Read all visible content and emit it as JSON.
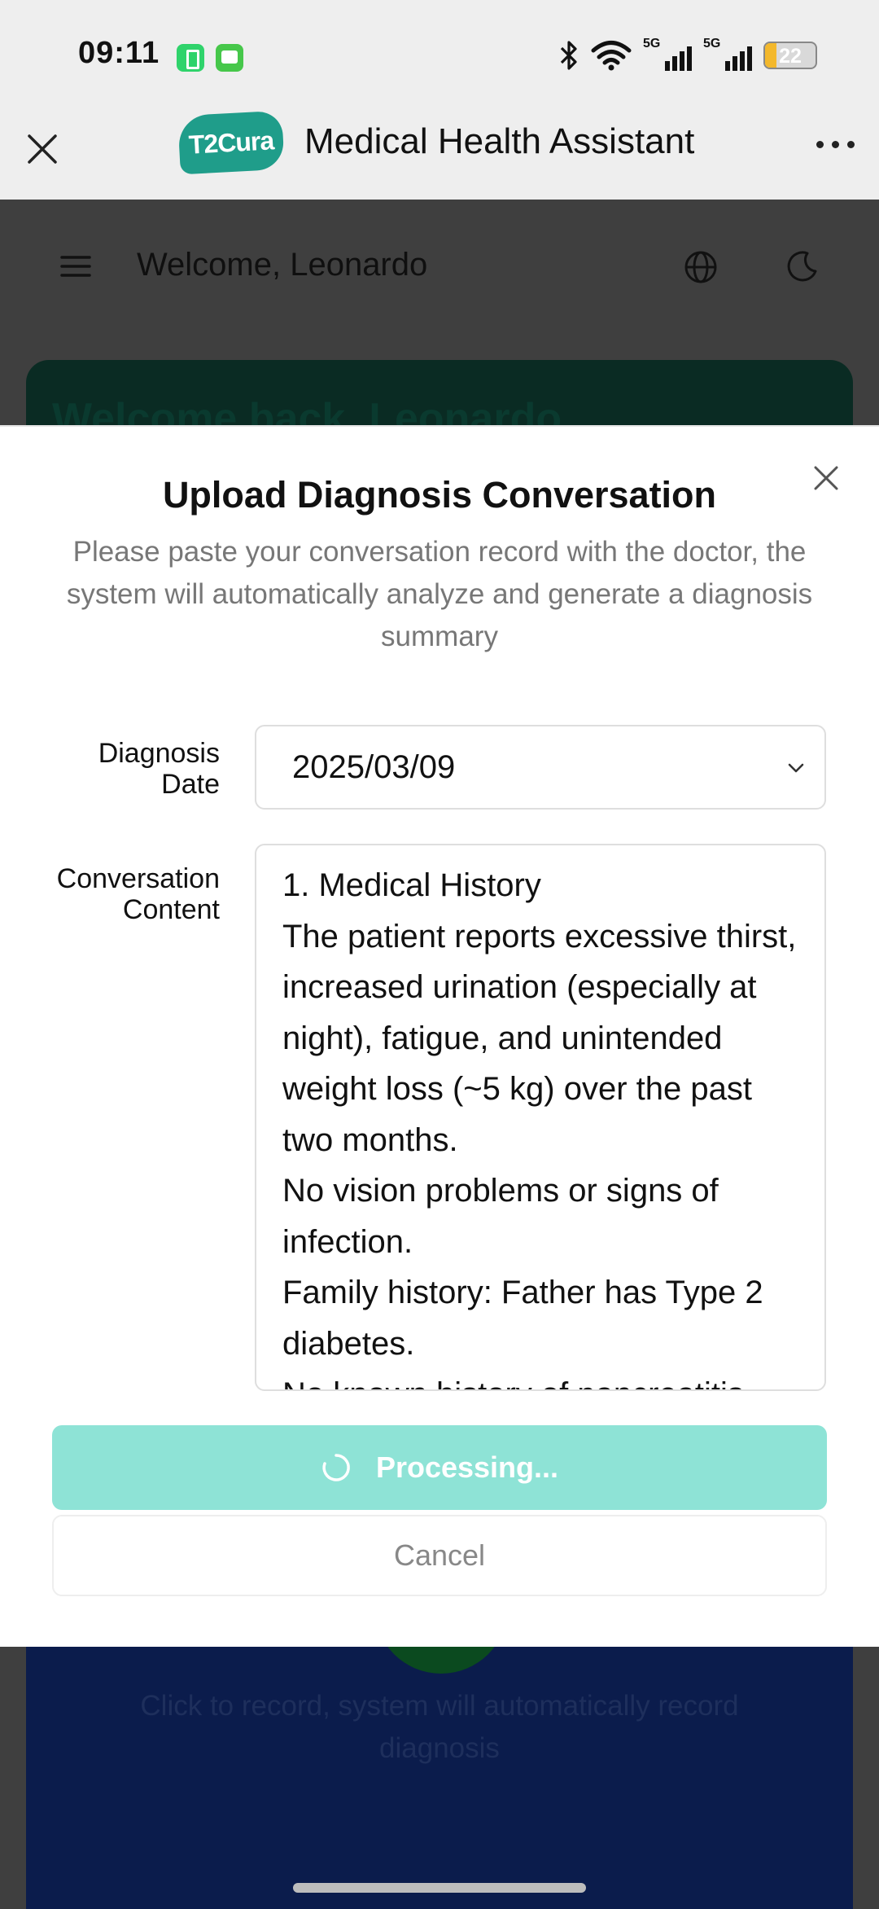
{
  "status_bar": {
    "time": "09:11",
    "network_1": "5G",
    "network_2": "5G",
    "battery_percent": "22",
    "battery_level": 0.22,
    "icons": [
      "battery-saver-icon",
      "messages-icon",
      "bluetooth-icon",
      "wifi-icon",
      "signal-icon",
      "battery-icon"
    ]
  },
  "app_bar": {
    "logo_text": "T2Cura",
    "title": "Medical Health Assistant",
    "icons": [
      "close-icon",
      "more-icon"
    ],
    "brand_color": "#1f9d8a"
  },
  "background_page": {
    "welcome": "Welcome, Leonardo",
    "welcome_back": "Welcome back, Leonardo",
    "record_hint": "Click to record, system will automatically record diagnosis",
    "icons": [
      "menu-icon",
      "globe-icon",
      "moon-icon",
      "microphone-icon"
    ]
  },
  "modal": {
    "title": "Upload Diagnosis Conversation",
    "description": "Please paste your conversation record with the doctor, the system will automatically analyze and generate a diagnosis summary",
    "date_label": "Diagnosis Date",
    "date_value": "2025/03/09",
    "content_label": "Conversation Content",
    "content_text": "1. Medical History\nThe patient reports excessive thirst, increased urination (especially at night), fatigue, and unintended weight loss (~5 kg) over the past two months.\nNo vision problems or signs of infection.\nFamily history: Father has Type 2 diabetes.\nNo known history of pancreatitis.",
    "processing_label": "Processing...",
    "cancel_label": "Cancel",
    "accent_color": "#8ee3d6"
  }
}
